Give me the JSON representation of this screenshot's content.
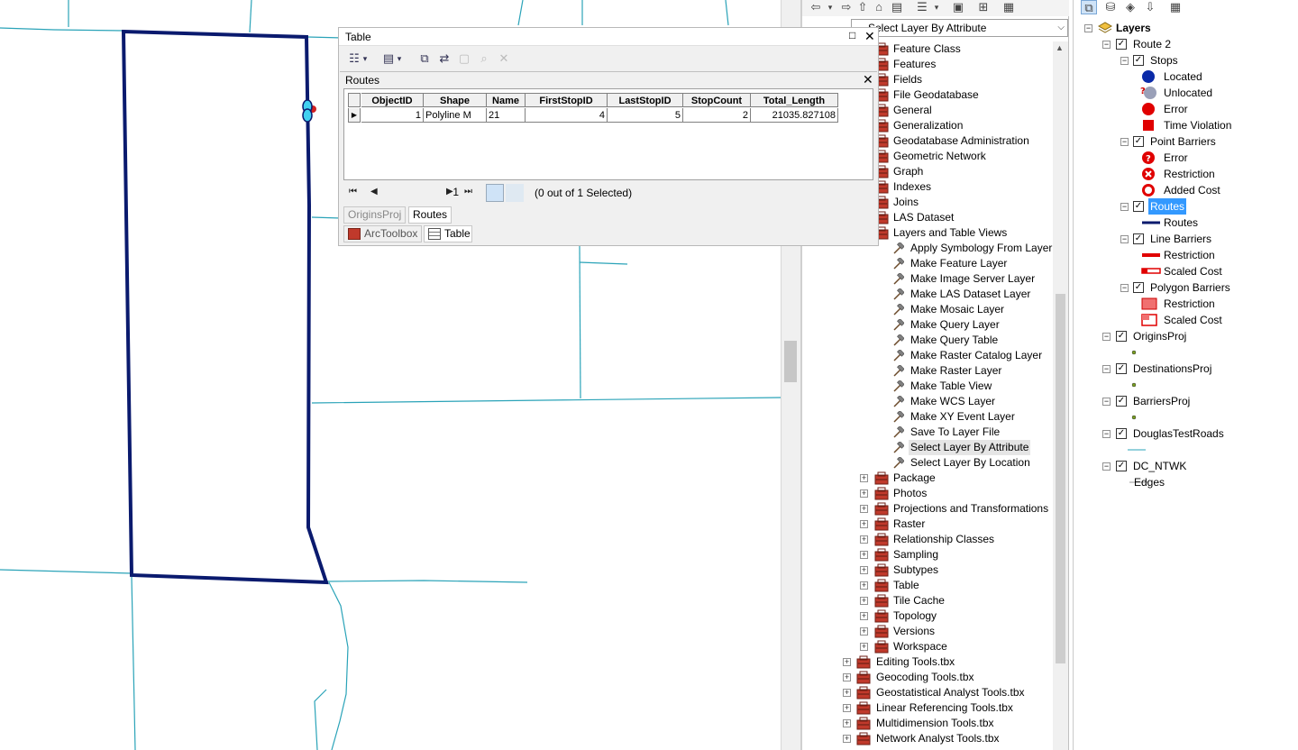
{
  "map": {
    "route_color": "#0a1a6e",
    "road_color": "#2aa3b8"
  },
  "toolbox": {
    "combo_value": "Select Layer By Attribute",
    "tree": [
      {
        "label": "Feature Class",
        "level": 1,
        "kind": "toolset"
      },
      {
        "label": "Features",
        "level": 1,
        "kind": "toolset"
      },
      {
        "label": "Fields",
        "level": 1,
        "kind": "toolset"
      },
      {
        "label": "File Geodatabase",
        "level": 1,
        "kind": "toolset"
      },
      {
        "label": "General",
        "level": 1,
        "kind": "toolset"
      },
      {
        "label": "Generalization",
        "level": 1,
        "kind": "toolset"
      },
      {
        "label": "Geodatabase Administration",
        "level": 1,
        "kind": "toolset"
      },
      {
        "label": "Geometric Network",
        "level": 1,
        "kind": "toolset"
      },
      {
        "label": "Graph",
        "level": 1,
        "kind": "toolset"
      },
      {
        "label": "Indexes",
        "level": 1,
        "kind": "toolset"
      },
      {
        "label": "Joins",
        "level": 1,
        "kind": "toolset"
      },
      {
        "label": "LAS Dataset",
        "level": 1,
        "kind": "toolset"
      },
      {
        "label": "Layers and Table Views",
        "level": 1,
        "kind": "toolset"
      },
      {
        "label": "Apply Symbology From Layer",
        "level": 2,
        "kind": "tool"
      },
      {
        "label": "Make Feature Layer",
        "level": 2,
        "kind": "tool"
      },
      {
        "label": "Make Image Server Layer",
        "level": 2,
        "kind": "tool"
      },
      {
        "label": "Make LAS Dataset Layer",
        "level": 2,
        "kind": "tool"
      },
      {
        "label": "Make Mosaic Layer",
        "level": 2,
        "kind": "tool"
      },
      {
        "label": "Make Query Layer",
        "level": 2,
        "kind": "tool"
      },
      {
        "label": "Make Query Table",
        "level": 2,
        "kind": "tool"
      },
      {
        "label": "Make Raster Catalog Layer",
        "level": 2,
        "kind": "tool"
      },
      {
        "label": "Make Raster Layer",
        "level": 2,
        "kind": "tool"
      },
      {
        "label": "Make Table View",
        "level": 2,
        "kind": "tool"
      },
      {
        "label": "Make WCS Layer",
        "level": 2,
        "kind": "tool"
      },
      {
        "label": "Make XY Event Layer",
        "level": 2,
        "kind": "tool"
      },
      {
        "label": "Save To Layer File",
        "level": 2,
        "kind": "tool"
      },
      {
        "label": "Select Layer By Attribute",
        "level": 2,
        "kind": "tool",
        "selected": true
      },
      {
        "label": "Select Layer By Location",
        "level": 2,
        "kind": "tool"
      },
      {
        "label": "Package",
        "level": 1,
        "kind": "toolset",
        "expander": "+"
      },
      {
        "label": "Photos",
        "level": 1,
        "kind": "toolset",
        "expander": "+"
      },
      {
        "label": "Projections and Transformations",
        "level": 1,
        "kind": "toolset",
        "expander": "+"
      },
      {
        "label": "Raster",
        "level": 1,
        "kind": "toolset",
        "expander": "+"
      },
      {
        "label": "Relationship Classes",
        "level": 1,
        "kind": "toolset",
        "expander": "+"
      },
      {
        "label": "Sampling",
        "level": 1,
        "kind": "toolset",
        "expander": "+"
      },
      {
        "label": "Subtypes",
        "level": 1,
        "kind": "toolset",
        "expander": "+"
      },
      {
        "label": "Table",
        "level": 1,
        "kind": "toolset",
        "expander": "+"
      },
      {
        "label": "Tile Cache",
        "level": 1,
        "kind": "toolset",
        "expander": "+"
      },
      {
        "label": "Topology",
        "level": 1,
        "kind": "toolset",
        "expander": "+"
      },
      {
        "label": "Versions",
        "level": 1,
        "kind": "toolset",
        "expander": "+"
      },
      {
        "label": "Workspace",
        "level": 1,
        "kind": "toolset",
        "expander": "+"
      },
      {
        "label": "Editing Tools.tbx",
        "level": 0,
        "kind": "toolbox",
        "expander": "+"
      },
      {
        "label": "Geocoding Tools.tbx",
        "level": 0,
        "kind": "toolbox",
        "expander": "+"
      },
      {
        "label": "Geostatistical Analyst Tools.tbx",
        "level": 0,
        "kind": "toolbox",
        "expander": "+"
      },
      {
        "label": "Linear Referencing Tools.tbx",
        "level": 0,
        "kind": "toolbox",
        "expander": "+"
      },
      {
        "label": "Multidimension Tools.tbx",
        "level": 0,
        "kind": "toolbox",
        "expander": "+"
      },
      {
        "label": "Network Analyst Tools.tbx",
        "level": 0,
        "kind": "toolbox",
        "expander": "+"
      }
    ]
  },
  "toc": {
    "rows": [
      {
        "label": "Layers",
        "indent": 0,
        "expander": "-",
        "check": false,
        "sym": "layers",
        "bold": true
      },
      {
        "label": "Route 2",
        "indent": 1,
        "expander": "-",
        "check": true
      },
      {
        "label": "Stops",
        "indent": 2,
        "expander": "-",
        "check": true
      },
      {
        "label": "Located",
        "indent": 3,
        "sym": "circle-blue"
      },
      {
        "label": "Unlocated",
        "indent": 3,
        "sym": "circle-gray-q"
      },
      {
        "label": "Error",
        "indent": 3,
        "sym": "circle-red"
      },
      {
        "label": "Time Violation",
        "indent": 3,
        "sym": "square-red"
      },
      {
        "label": "Point Barriers",
        "indent": 2,
        "expander": "-",
        "check": true
      },
      {
        "label": "Error",
        "indent": 3,
        "sym": "q-red"
      },
      {
        "label": "Restriction",
        "indent": 3,
        "sym": "x-red"
      },
      {
        "label": "Added Cost",
        "indent": 3,
        "sym": "gear-red"
      },
      {
        "label": "Routes",
        "indent": 2,
        "expander": "-",
        "check": true,
        "selected": true
      },
      {
        "label": "Routes",
        "indent": 3,
        "sym": "line-navy"
      },
      {
        "label": "Line Barriers",
        "indent": 2,
        "expander": "-",
        "check": true
      },
      {
        "label": "Restriction",
        "indent": 3,
        "sym": "line-red"
      },
      {
        "label": "Scaled Cost",
        "indent": 3,
        "sym": "line-red-hollow"
      },
      {
        "label": "Polygon Barriers",
        "indent": 2,
        "expander": "-",
        "check": true
      },
      {
        "label": "Restriction",
        "indent": 3,
        "sym": "poly-red"
      },
      {
        "label": "Scaled Cost",
        "indent": 3,
        "sym": "poly-red-hollow"
      },
      {
        "label": "OriginsProj",
        "indent": 1,
        "expander": "-",
        "check": true,
        "gap": true
      },
      {
        "label": "",
        "indent": 3,
        "sym": "dot-green"
      },
      {
        "label": "DestinationsProj",
        "indent": 1,
        "expander": "-",
        "check": true,
        "gap": true
      },
      {
        "label": "",
        "indent": 3,
        "sym": "dot-green"
      },
      {
        "label": "BarriersProj",
        "indent": 1,
        "expander": "-",
        "check": true,
        "gap": true
      },
      {
        "label": "",
        "indent": 3,
        "sym": "dot-green"
      },
      {
        "label": "DouglasTestRoads",
        "indent": 1,
        "expander": "-",
        "check": true,
        "gap": true
      },
      {
        "label": "",
        "indent": 3,
        "sym": "line-teal"
      },
      {
        "label": "DC_NTWK",
        "indent": 1,
        "expander": "-",
        "check": true,
        "gap": true
      },
      {
        "label": "Edges",
        "indent": 3,
        "sym": "line-gray"
      }
    ]
  },
  "table": {
    "title": "Table",
    "subtitle": "Routes",
    "columns": [
      "ObjectID",
      "Shape",
      "Name",
      "FirstStopID",
      "LastStopID",
      "StopCount",
      "Total_Length"
    ],
    "row": [
      "1",
      "Polyline M",
      "21",
      "4",
      "5",
      "2",
      "21035.827108"
    ],
    "page": "1",
    "selection": "(0 out of 1 Selected)",
    "tabs": [
      "OriginsProj",
      "Routes"
    ],
    "bottom_tabs": [
      "ArcToolbox",
      "Table"
    ]
  }
}
